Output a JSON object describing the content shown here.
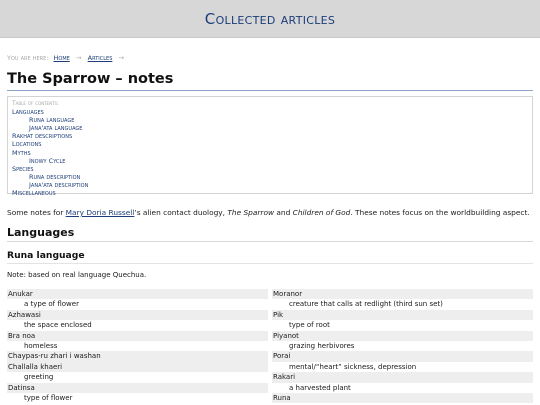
{
  "site": {
    "title": "Collected articles"
  },
  "breadcrumb": {
    "prefix": "You are here:",
    "items": [
      "Home",
      "Articles"
    ],
    "separator": "→"
  },
  "page": {
    "title": "The Sparrow – notes"
  },
  "toc": {
    "title": "Table of contents:",
    "items": [
      {
        "label": "Languages",
        "level": 1
      },
      {
        "label": "Runa language",
        "level": 2
      },
      {
        "label": "Jana'ata language",
        "level": 2
      },
      {
        "label": "Rakhat descriptions",
        "level": 1
      },
      {
        "label": "Locations",
        "level": 1
      },
      {
        "label": "Myths",
        "level": 1
      },
      {
        "label": "Inowy Cycle",
        "level": 2
      },
      {
        "label": "Species",
        "level": 1
      },
      {
        "label": "Runa description",
        "level": 2
      },
      {
        "label": "Jana'ata description",
        "level": 2
      },
      {
        "label": "Miscellaneous",
        "level": 1
      }
    ]
  },
  "intro": {
    "before": "Some notes for ",
    "author_link": "Mary Doria Russell",
    "middle": "’s alien contact duology, ",
    "book1": "The Sparrow",
    "and": " and ",
    "book2": "Children of God",
    "after": ". These notes focus on the worldbuilding aspect."
  },
  "section": {
    "heading": "Languages"
  },
  "subsection": {
    "heading": "Runa language",
    "note": "Note: based on real language Quechua."
  },
  "glossary": {
    "left": [
      {
        "term": "Anukar",
        "def": "a type of flower"
      },
      {
        "term": "Azhawasi",
        "def": "the space enclosed"
      },
      {
        "term": "Bra noa",
        "def": "homeless"
      },
      {
        "term": "Chaypas-ru zhari i washan",
        "def": null
      },
      {
        "term": "Challalla khaeri",
        "def": "greeting"
      },
      {
        "term": "Datinsa",
        "def": "type of flower"
      }
    ],
    "right": [
      {
        "term": "Moranor",
        "def": "creature that calls at redlight (third sun set)"
      },
      {
        "term": "Pik",
        "def": "type of root"
      },
      {
        "term": "Piyanot",
        "def": "grazing herbivores"
      },
      {
        "term": "Porai",
        "def": "mental/“heart” sickness, depression"
      },
      {
        "term": "Rakari",
        "def": "a harvested plant"
      },
      {
        "term": "Runa",
        "def": null
      }
    ]
  }
}
